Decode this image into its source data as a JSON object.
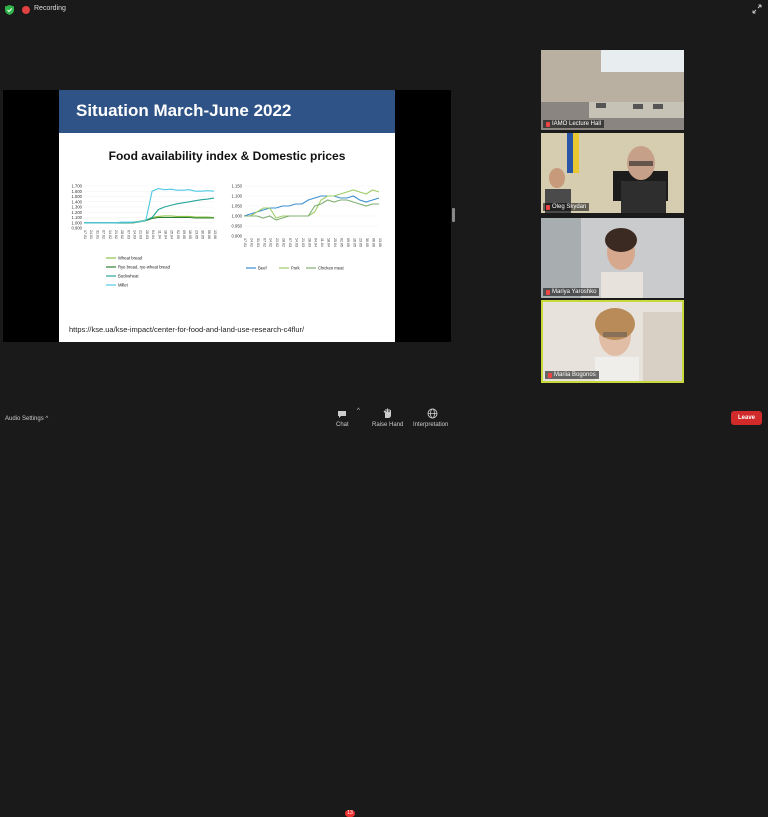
{
  "recording": {
    "label": "Recording"
  },
  "slide": {
    "title": "Situation March-June 2022",
    "heading": "Food availability index & Domestic prices",
    "link": "https://kse.ua/kse-impact/center-for-food-and-land-use-research-c4flur/"
  },
  "participants": [
    {
      "name": "IAMO Lecture Hall"
    },
    {
      "name": "Oleg Skydan"
    },
    {
      "name": "Mariya Yaroshko"
    },
    {
      "name": "Mariia Bogonos"
    }
  ],
  "toolbar": {
    "audio_settings": "Audio Settings",
    "chat": "Chat",
    "chat_badge": "13",
    "raise_hand": "Raise Hand",
    "interpretation": "Interpretation",
    "leave": "Leave"
  },
  "chart_data": [
    {
      "type": "line",
      "title": "",
      "categories": [
        "17.01",
        "24.01",
        "31.01",
        "07.02",
        "14.02",
        "21.02",
        "28.02",
        "07.03",
        "14.03",
        "21.03",
        "28.03",
        "04.04",
        "11.04",
        "18.04",
        "25.04",
        "02.05",
        "09.05",
        "16.05",
        "23.05",
        "30.05",
        "06.06",
        "13.06"
      ],
      "ylim": [
        0.9,
        1.7
      ],
      "yticks": [
        "1.700",
        "1.600",
        "1.500",
        "1.400",
        "1.300",
        "1.200",
        "1.100",
        "1.000",
        "0.900"
      ],
      "series": [
        {
          "name": "Wheat bread",
          "color": "#8bc34a",
          "values": [
            1.0,
            1.0,
            1.0,
            1.0,
            1.0,
            1.0,
            1.0,
            1.0,
            1.01,
            1.03,
            1.05,
            1.1,
            1.12,
            1.13,
            1.13,
            1.12,
            1.12,
            1.12,
            1.11,
            1.11,
            1.11,
            1.1
          ]
        },
        {
          "name": "Rye bread, rye-wheat bread",
          "color": "#2e7d32",
          "values": [
            1.0,
            1.0,
            1.0,
            1.0,
            1.0,
            1.0,
            1.0,
            1.0,
            1.0,
            1.02,
            1.04,
            1.08,
            1.1,
            1.1,
            1.1,
            1.1,
            1.1,
            1.1,
            1.09,
            1.09,
            1.09,
            1.09
          ]
        },
        {
          "name": "Buckwheat",
          "color": "#26a69a",
          "values": [
            1.0,
            1.0,
            1.0,
            1.0,
            1.0,
            1.0,
            1.0,
            1.0,
            1.01,
            1.02,
            1.05,
            1.1,
            1.25,
            1.3,
            1.33,
            1.36,
            1.38,
            1.4,
            1.42,
            1.44,
            1.45,
            1.47
          ]
        },
        {
          "name": "Millet",
          "color": "#4ec9e3",
          "values": [
            1.0,
            1.0,
            1.0,
            1.0,
            1.0,
            1.0,
            1.01,
            1.01,
            1.01,
            1.02,
            1.05,
            1.6,
            1.65,
            1.63,
            1.64,
            1.62,
            1.62,
            1.63,
            1.6,
            1.6,
            1.61,
            1.6
          ]
        }
      ]
    },
    {
      "type": "line",
      "title": "",
      "categories": [
        "17.01",
        "24.01",
        "31.01",
        "07.02",
        "14.02",
        "21.02",
        "28.02",
        "07.03",
        "14.03",
        "21.03",
        "28.03",
        "04.04",
        "11.04",
        "18.04",
        "25.04",
        "02.05",
        "09.05",
        "16.05",
        "23.05",
        "30.05",
        "06.06",
        "13.06"
      ],
      "ylim": [
        0.9,
        1.15
      ],
      "yticks": [
        "1.150",
        "1.100",
        "1.050",
        "1.000",
        "0.950",
        "0.900"
      ],
      "series": [
        {
          "name": "Beef",
          "color": "#3a8fd1",
          "values": [
            1.0,
            1.01,
            1.02,
            1.03,
            1.04,
            1.04,
            1.05,
            1.05,
            1.06,
            1.06,
            1.08,
            1.09,
            1.1,
            1.1,
            1.1,
            1.09,
            1.09,
            1.1,
            1.08,
            1.07,
            1.08,
            1.09
          ]
        },
        {
          "name": "Pork",
          "color": "#9ccc65",
          "values": [
            1.0,
            1.0,
            1.02,
            1.04,
            1.04,
            0.99,
            1.0,
            1.0,
            1.0,
            1.0,
            1.0,
            1.02,
            1.08,
            1.1,
            1.1,
            1.11,
            1.12,
            1.13,
            1.12,
            1.11,
            1.13,
            1.12
          ]
        },
        {
          "name": "Chicken meat",
          "color": "#7fae72",
          "values": [
            1.0,
            1.0,
            1.0,
            0.99,
            1.0,
            0.98,
            0.99,
            1.0,
            1.0,
            1.0,
            1.0,
            1.05,
            1.06,
            1.08,
            1.07,
            1.08,
            1.08,
            1.07,
            1.06,
            1.05,
            1.06,
            1.06
          ]
        }
      ]
    }
  ]
}
